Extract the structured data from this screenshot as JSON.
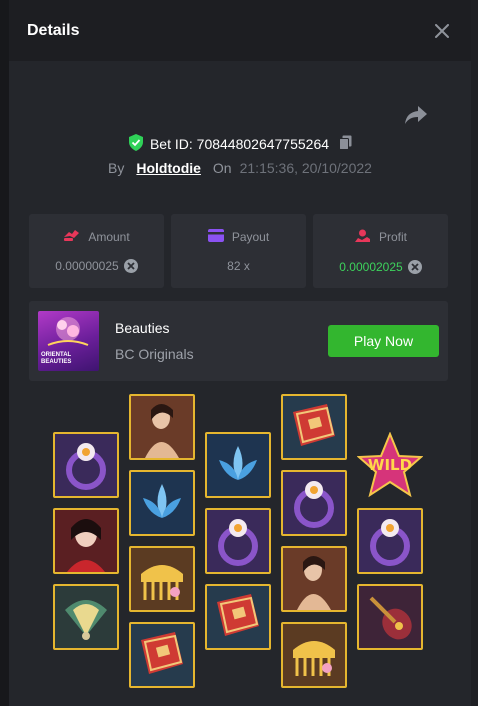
{
  "modal": {
    "title": "Details"
  },
  "bet": {
    "id_label": "Bet ID: 70844802647755264",
    "by_label": "By",
    "username": "Holdtodie",
    "on_label": "On",
    "datetime": "21:15:36, 20/10/2022"
  },
  "stats": {
    "amount": {
      "label": "Amount",
      "value": "0.00000025"
    },
    "payout": {
      "label": "Payout",
      "value": "82 x"
    },
    "profit": {
      "label": "Profit",
      "value": "0.00002025"
    }
  },
  "game": {
    "thumbnail_text": "ORIENTAL BEAUTIES",
    "name": "Beauties",
    "provider": "BC Originals",
    "play_label": "Play Now"
  },
  "reels": {
    "wild_label": "WILD",
    "columns": [
      [
        "ring",
        "woman",
        "fan"
      ],
      [
        "woman-nude",
        "lotus",
        "comb",
        "book"
      ],
      [
        "lotus",
        "ring",
        "book"
      ],
      [
        "book",
        "ring",
        "woman-nude",
        "comb"
      ],
      [
        "wild",
        "ring",
        "pipa"
      ]
    ]
  },
  "colors": {
    "accent_green": "#33b62f",
    "profit_green": "#3dd25c",
    "tile_border": "#e5b62f",
    "shield_green": "#2fd158"
  }
}
